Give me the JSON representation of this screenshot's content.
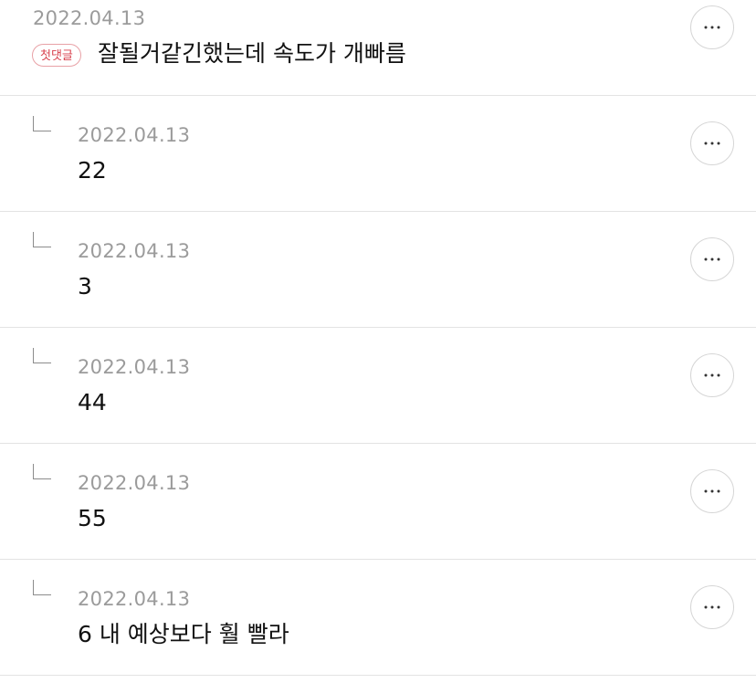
{
  "comments": [
    {
      "date": "2022.04.13",
      "badge": "첫댓글",
      "text": "잘될거같긴했는데 속도가 개빠름",
      "more_icon": "more-horizontal-icon"
    },
    {
      "date": "2022.04.13",
      "text": "22",
      "reply_icon": "reply-arrow-icon",
      "more_icon": "more-horizontal-icon"
    },
    {
      "date": "2022.04.13",
      "text": "3",
      "reply_icon": "reply-arrow-icon",
      "more_icon": "more-horizontal-icon"
    },
    {
      "date": "2022.04.13",
      "text": "44",
      "reply_icon": "reply-arrow-icon",
      "more_icon": "more-horizontal-icon"
    },
    {
      "date": "2022.04.13",
      "text": "55",
      "reply_icon": "reply-arrow-icon",
      "more_icon": "more-horizontal-icon"
    },
    {
      "date": "2022.04.13",
      "text": "6 내 예상보다 훨 빨라",
      "reply_icon": "reply-arrow-icon",
      "more_icon": "more-horizontal-icon"
    }
  ],
  "colors": {
    "badge_text": "#d8424e",
    "badge_border": "#e8a1a6",
    "date_text": "#9b9b9b",
    "divider": "#e3e3e3"
  }
}
